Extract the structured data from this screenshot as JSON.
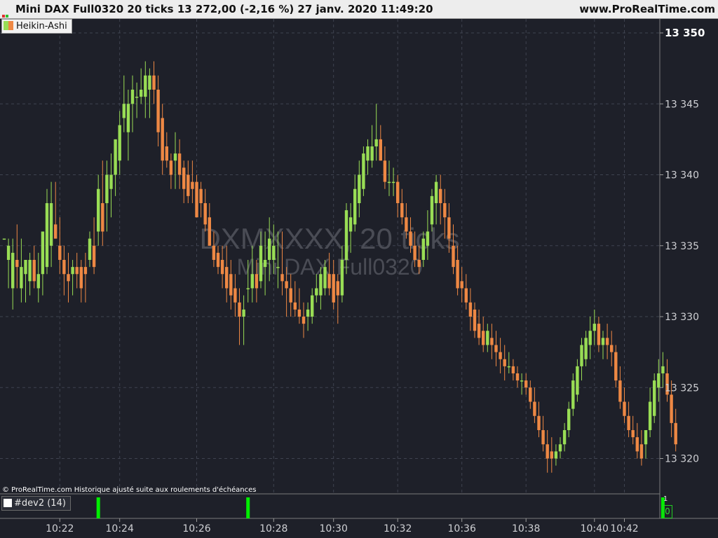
{
  "header": {
    "title": "Mini DAX Full0320 20 ticks 13 272,00 (-2,16 %) 27 janv. 2020 11:49:20",
    "site": "www.ProRealTime.com"
  },
  "legend": {
    "price_label": "Heikin-Ashi"
  },
  "watermark": {
    "line1": "DXMXXXX, 20 ticks",
    "line2": "Mini DAX Full0320"
  },
  "copyright": "© ProRealTime.com  Historique ajusté suite aux roulements d'échéances",
  "indicator": {
    "label": "#dev2 (14)",
    "scale_top": "1",
    "value": "0",
    "signals_at_bar": [
      22,
      57,
      154
    ]
  },
  "colors": {
    "up": "#99dd55",
    "down": "#ee8844",
    "signal": "#00ee00",
    "background": "#1e2029",
    "grid": "#3f4350"
  },
  "chart_data": {
    "type": "candlestick",
    "style": "heikin-ashi",
    "ylim": [
      13318,
      13352
    ],
    "yticks": [
      "13 350",
      "13 345",
      "13 340",
      "13 335",
      "13 330",
      "13 325",
      "13 320"
    ],
    "ytick_values": [
      13350,
      13345,
      13340,
      13335,
      13330,
      13325,
      13320
    ],
    "xticks": [
      {
        "label": "10:22",
        "bar": 13
      },
      {
        "label": "10:24",
        "bar": 27
      },
      {
        "label": "10:26",
        "bar": 45
      },
      {
        "label": "10:28",
        "bar": 63
      },
      {
        "label": "10:30",
        "bar": 77
      },
      {
        "label": "10:32",
        "bar": 92
      },
      {
        "label": "10:36",
        "bar": 107
      },
      {
        "label": "10:38",
        "bar": 122
      },
      {
        "label": "10:40",
        "bar": 138
      },
      {
        "label": "10:42",
        "bar": 145
      }
    ],
    "grid": true,
    "ohlc": [
      [
        13335.5,
        13335.5,
        13335.5,
        13335.5
      ],
      [
        13334,
        13335.5,
        13332,
        13335
      ],
      [
        13332,
        13335.5,
        13330.5,
        13334.5
      ],
      [
        13334,
        13336.5,
        13332,
        13333.5
      ],
      [
        13332,
        13335.5,
        13331,
        13333.5
      ],
      [
        13333,
        13334,
        13331,
        13334
      ],
      [
        13332.5,
        13334.5,
        13331.5,
        13334
      ],
      [
        13334,
        13335,
        13332,
        13332.5
      ],
      [
        13332,
        13334.5,
        13331,
        13333
      ],
      [
        13333,
        13335.5,
        13331.5,
        13336
      ],
      [
        13333.5,
        13339,
        13333,
        13338
      ],
      [
        13335,
        13339.5,
        13333.5,
        13338
      ],
      [
        13336.5,
        13339.5,
        13335.5,
        13335.5
      ],
      [
        13335,
        13337,
        13333,
        13334
      ],
      [
        13334,
        13335,
        13331.5,
        13333
      ],
      [
        13333,
        13334.5,
        13331,
        13332.5
      ],
      [
        13333,
        13334,
        13331.5,
        13333.5
      ],
      [
        13333.5,
        13334.5,
        13332,
        13333
      ],
      [
        13333.5,
        13334,
        13331,
        13332
      ],
      [
        13333.5,
        13334.5,
        13331,
        13333
      ],
      [
        13334,
        13336,
        13333.5,
        13335.5
      ],
      [
        13335,
        13337,
        13333,
        13333.5
      ],
      [
        13336,
        13340,
        13335,
        13339
      ],
      [
        13338,
        13341,
        13335,
        13336
      ],
      [
        13338,
        13341,
        13336,
        13340
      ],
      [
        13339,
        13341.5,
        13337,
        13340
      ],
      [
        13340,
        13342.5,
        13338.5,
        13342.5
      ],
      [
        13341,
        13344.5,
        13340,
        13343.5
      ],
      [
        13344,
        13347,
        13343,
        13345
      ],
      [
        13343,
        13346,
        13341,
        13345
      ],
      [
        13345,
        13347,
        13343,
        13346
      ],
      [
        13345.5,
        13346.5,
        13344,
        13345.5
      ],
      [
        13345.5,
        13347.5,
        13345,
        13346
      ],
      [
        13345.5,
        13348,
        13344,
        13347
      ],
      [
        13346,
        13347.5,
        13344,
        13347
      ],
      [
        13347,
        13348,
        13345,
        13346
      ],
      [
        13346,
        13347,
        13342,
        13343
      ],
      [
        13344,
        13345,
        13340,
        13341
      ],
      [
        13342,
        13343,
        13340.5,
        13341
      ],
      [
        13341,
        13341.5,
        13339,
        13340
      ],
      [
        13341,
        13343,
        13339,
        13341.5
      ],
      [
        13341.5,
        13342.5,
        13339,
        13340
      ],
      [
        13340.5,
        13341,
        13338,
        13339
      ],
      [
        13340,
        13341,
        13338,
        13338.5
      ],
      [
        13339.5,
        13341,
        13338,
        13339
      ],
      [
        13339.5,
        13340,
        13337,
        13337
      ],
      [
        13339,
        13339.5,
        13337,
        13338
      ],
      [
        13338,
        13339,
        13336,
        13336.5
      ],
      [
        13337,
        13338,
        13335,
        13335
      ],
      [
        13335,
        13336,
        13333.5,
        13334
      ],
      [
        13334.5,
        13335,
        13333,
        13333.5
      ],
      [
        13334,
        13335,
        13332,
        13333
      ],
      [
        13333.5,
        13335,
        13331,
        13332
      ],
      [
        13333,
        13334,
        13330.5,
        13331.5
      ],
      [
        13332,
        13333,
        13330,
        13331
      ],
      [
        13331,
        13332,
        13328,
        13330
      ],
      [
        13330,
        13331.5,
        13328,
        13330.5
      ],
      [
        13332,
        13334,
        13331,
        13332
      ],
      [
        13332,
        13335,
        13331,
        13333
      ],
      [
        13333,
        13334,
        13331,
        13332
      ],
      [
        13332.5,
        13336,
        13332,
        13335
      ],
      [
        13333.5,
        13336,
        13331.5,
        13334
      ],
      [
        13334,
        13337,
        13332.5,
        13335.5
      ],
      [
        13334,
        13336.5,
        13333,
        13335
      ],
      [
        13333.5,
        13336,
        13332,
        13333.5
      ],
      [
        13333,
        13336,
        13331.5,
        13332.5
      ],
      [
        13332.5,
        13333.5,
        13330,
        13332
      ],
      [
        13332,
        13333,
        13330,
        13331
      ],
      [
        13331,
        13332.5,
        13330,
        13330.5
      ],
      [
        13330.5,
        13332,
        13329.5,
        13330
      ],
      [
        13330,
        13331,
        13328.5,
        13329.5
      ],
      [
        13330,
        13331,
        13329,
        13330.5
      ],
      [
        13330,
        13332,
        13329.5,
        13331.5
      ],
      [
        13331.5,
        13333,
        13331,
        13332
      ],
      [
        13331.5,
        13333.5,
        13330.5,
        13333
      ],
      [
        13332,
        13334,
        13331.5,
        13333.5
      ],
      [
        13333,
        13334.5,
        13331.5,
        13332
      ],
      [
        13333,
        13334,
        13330.5,
        13331
      ],
      [
        13332.5,
        13333,
        13329.5,
        13331.5
      ],
      [
        13331.5,
        13335,
        13331,
        13334
      ],
      [
        13334,
        13338,
        13333,
        13337.5
      ],
      [
        13336,
        13338,
        13334.5,
        13337
      ],
      [
        13336.5,
        13340,
        13336,
        13339
      ],
      [
        13338,
        13341,
        13337,
        13340
      ],
      [
        13339,
        13342,
        13338.5,
        13341.5
      ],
      [
        13341,
        13342.5,
        13340,
        13342
      ],
      [
        13341,
        13343.5,
        13340.5,
        13342
      ],
      [
        13342,
        13345,
        13341,
        13342.5
      ],
      [
        13342.5,
        13343.5,
        13341,
        13341
      ],
      [
        13341,
        13342,
        13339,
        13339.5
      ],
      [
        13339.5,
        13341,
        13338.5,
        13339.5
      ],
      [
        13339.5,
        13340.5,
        13338.5,
        13339.5
      ],
      [
        13339.5,
        13340,
        13337,
        13338
      ],
      [
        13338,
        13339,
        13336.5,
        13337
      ],
      [
        13337,
        13338,
        13335.5,
        13336
      ],
      [
        13336,
        13337,
        13334.5,
        13335
      ],
      [
        13335,
        13336,
        13333.5,
        13334
      ],
      [
        13334,
        13335,
        13333,
        13333.5
      ],
      [
        13334,
        13336,
        13333.5,
        13335.5
      ],
      [
        13335,
        13337.5,
        13334,
        13336
      ],
      [
        13336.5,
        13339,
        13336,
        13338.5
      ],
      [
        13338,
        13340,
        13336.5,
        13339.5
      ],
      [
        13339,
        13340,
        13336.5,
        13338
      ],
      [
        13338,
        13339,
        13335.5,
        13337
      ],
      [
        13337,
        13338,
        13334.5,
        13335.5
      ],
      [
        13335,
        13336.5,
        13333,
        13333.5
      ],
      [
        13334,
        13335,
        13331.5,
        13332
      ],
      [
        13332.5,
        13333.5,
        13331,
        13332
      ],
      [
        13332,
        13333,
        13330.5,
        13331
      ],
      [
        13331,
        13332,
        13329,
        13330
      ],
      [
        13330.5,
        13331,
        13328.5,
        13329
      ],
      [
        13329.5,
        13330.5,
        13328,
        13328.5
      ],
      [
        13329,
        13330,
        13327.5,
        13328
      ],
      [
        13328,
        13329.5,
        13327.5,
        13329
      ],
      [
        13328.5,
        13329.5,
        13327,
        13328
      ],
      [
        13328,
        13329,
        13326.5,
        13327.5
      ],
      [
        13327.5,
        13328.5,
        13326,
        13327
      ],
      [
        13327,
        13328,
        13325.5,
        13326.5
      ],
      [
        13326.5,
        13327.5,
        13326,
        13326.5
      ],
      [
        13326.5,
        13327,
        13325.5,
        13326
      ],
      [
        13326,
        13326.5,
        13325,
        13325.5
      ],
      [
        13325.5,
        13326,
        13324.5,
        13325.5
      ],
      [
        13325.5,
        13326,
        13324.5,
        13325
      ],
      [
        13325,
        13325.5,
        13323.5,
        13324
      ],
      [
        13324,
        13325,
        13322.5,
        13323
      ],
      [
        13323,
        13324,
        13321.5,
        13322
      ],
      [
        13322,
        13323,
        13320.5,
        13321
      ],
      [
        13321,
        13322,
        13319,
        13320
      ],
      [
        13320.5,
        13321.5,
        13319,
        13320
      ],
      [
        13320,
        13321,
        13319.5,
        13320.5
      ],
      [
        13320.5,
        13321.5,
        13320,
        13321
      ],
      [
        13321,
        13322.5,
        13320.5,
        13322
      ],
      [
        13322,
        13324,
        13321.5,
        13323.5
      ],
      [
        13323.5,
        13326,
        13323,
        13325.5
      ],
      [
        13324.5,
        13327,
        13324,
        13326.5
      ],
      [
        13326.5,
        13328.5,
        13325.5,
        13328
      ],
      [
        13327,
        13329,
        13326.5,
        13328.5
      ],
      [
        13328,
        13330,
        13327,
        13329
      ],
      [
        13329,
        13330.5,
        13328,
        13329.5
      ],
      [
        13329.5,
        13330,
        13327.5,
        13328
      ],
      [
        13328,
        13329,
        13327,
        13328.5
      ],
      [
        13328.5,
        13329.5,
        13327,
        13328
      ],
      [
        13328,
        13329,
        13326.5,
        13327.5
      ],
      [
        13327.5,
        13328,
        13325,
        13325.5
      ],
      [
        13325.5,
        13326.5,
        13323.5,
        13324
      ],
      [
        13324,
        13325,
        13322.5,
        13323
      ],
      [
        13323,
        13324,
        13321.5,
        13322
      ],
      [
        13322,
        13323,
        13321,
        13321.5
      ],
      [
        13321.5,
        13322.5,
        13320,
        13320.5
      ],
      [
        13321,
        13322,
        13319.5,
        13320
      ],
      [
        13321,
        13322,
        13320,
        13322
      ],
      [
        13322,
        13325,
        13321.5,
        13324
      ],
      [
        13323,
        13326,
        13322.5,
        13325.5
      ],
      [
        13325,
        13327,
        13324,
        13326
      ],
      [
        13326,
        13327.5,
        13325,
        13326.5
      ],
      [
        13326,
        13327,
        13324,
        13324.5
      ],
      [
        13324.5,
        13325.5,
        13321.5,
        13322.5
      ],
      [
        13322.5,
        13323.5,
        13320.5,
        13321
      ]
    ]
  }
}
